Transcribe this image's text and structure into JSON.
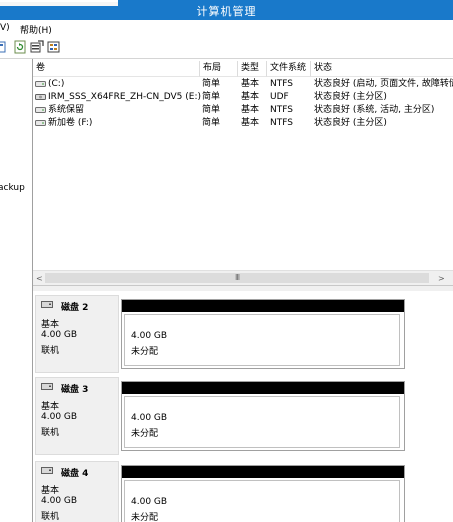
{
  "window": {
    "title": "计算机管理"
  },
  "menu": {
    "view_fragment": "V)",
    "help": "帮助(H)"
  },
  "left_pane": {
    "item_fragment": "ackup"
  },
  "volume_list": {
    "columns": [
      "卷",
      "布局",
      "类型",
      "文件系统",
      "状态"
    ],
    "rows": [
      {
        "name": "(C:)",
        "layout": "简单",
        "type": "基本",
        "fs": "NTFS",
        "status": "状态良好 (启动, 页面文件, 故障转储"
      },
      {
        "name": "IRM_SSS_X64FRE_ZH-CN_DV5 (E:)",
        "layout": "简单",
        "type": "基本",
        "fs": "UDF",
        "status": "状态良好 (主分区)"
      },
      {
        "name": "系统保留",
        "layout": "简单",
        "type": "基本",
        "fs": "NTFS",
        "status": "状态良好 (系统, 活动, 主分区)"
      },
      {
        "name": "新加卷 (F:)",
        "layout": "简单",
        "type": "基本",
        "fs": "NTFS",
        "status": "状态良好 (主分区)"
      }
    ],
    "scroll_grip": "III"
  },
  "disks": [
    {
      "name": "磁盘 2",
      "type": "基本",
      "size": "4.00 GB",
      "state": "联机",
      "part_size": "4.00 GB",
      "part_status": "未分配"
    },
    {
      "name": "磁盘 3",
      "type": "基本",
      "size": "4.00 GB",
      "state": "联机",
      "part_size": "4.00 GB",
      "part_status": "未分配"
    },
    {
      "name": "磁盘 4",
      "type": "基本",
      "size": "4.00 GB",
      "state": "联机",
      "part_size": "4.00 GB",
      "part_status": "未分配"
    }
  ],
  "colors": {
    "titlebar": "#1979ca",
    "unallocated_bar": "#000000"
  }
}
